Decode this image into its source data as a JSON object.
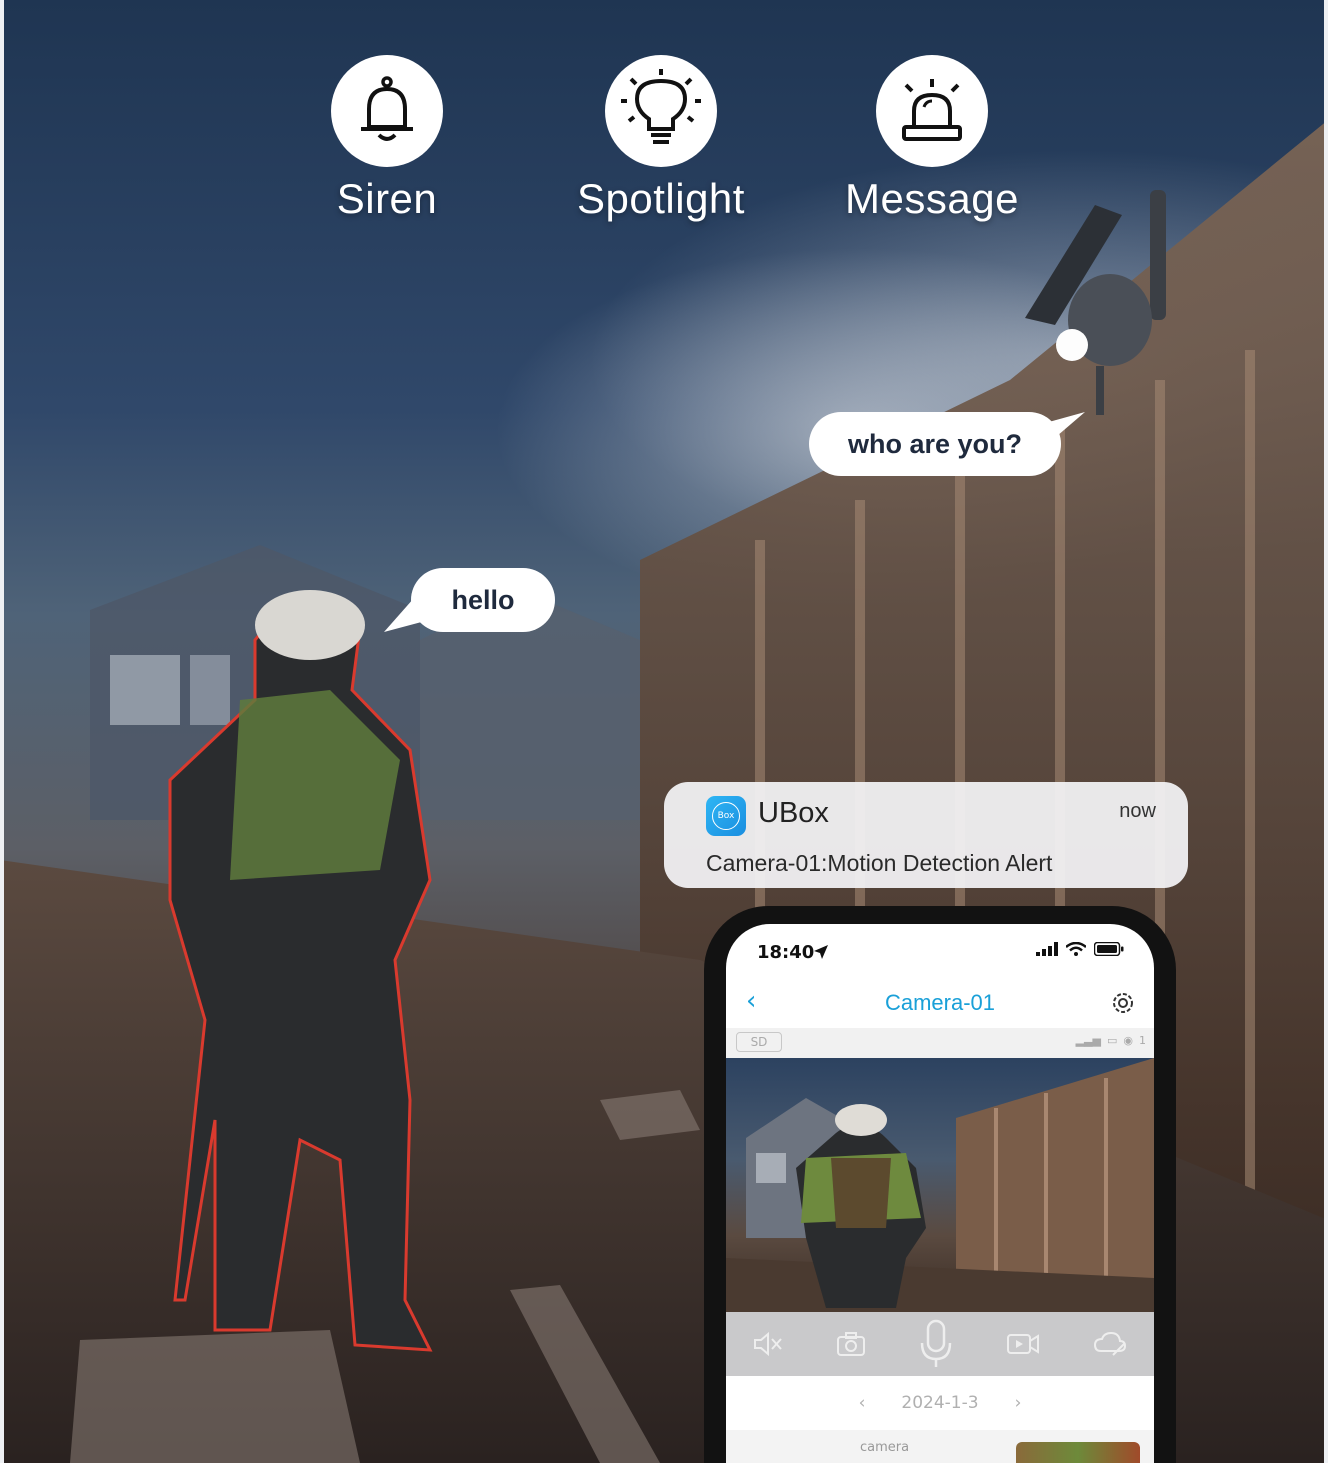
{
  "features": [
    {
      "label": "Siren",
      "icon": "bell-icon"
    },
    {
      "label": "Spotlight",
      "icon": "lightbulb-icon"
    },
    {
      "label": "Message",
      "icon": "alarm-light-icon"
    }
  ],
  "bubbles": {
    "camera_speech": "who are you?",
    "person_speech": "hello"
  },
  "notification": {
    "app_name": "UBox",
    "logo_text": "Box",
    "time": "now",
    "message": "Camera-01:Motion Detection Alert"
  },
  "phone": {
    "status_time": "18:40",
    "title": "Camera-01",
    "quality_badge": "SD",
    "viewer_count": "1",
    "date": "2024-1-3",
    "list_label": "camera",
    "accent_color": "#1aa0d8"
  }
}
